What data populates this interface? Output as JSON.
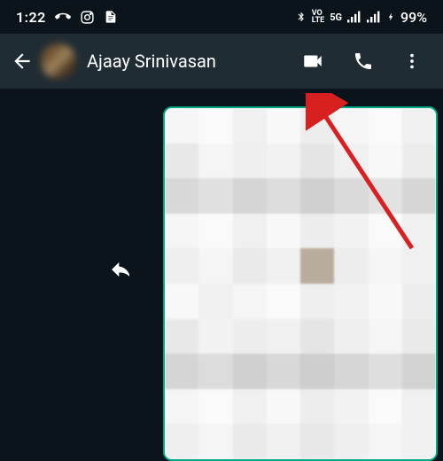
{
  "status": {
    "time": "1:22",
    "battery": "99%"
  },
  "header": {
    "contact_name": "Ajaay Srinivasan"
  }
}
